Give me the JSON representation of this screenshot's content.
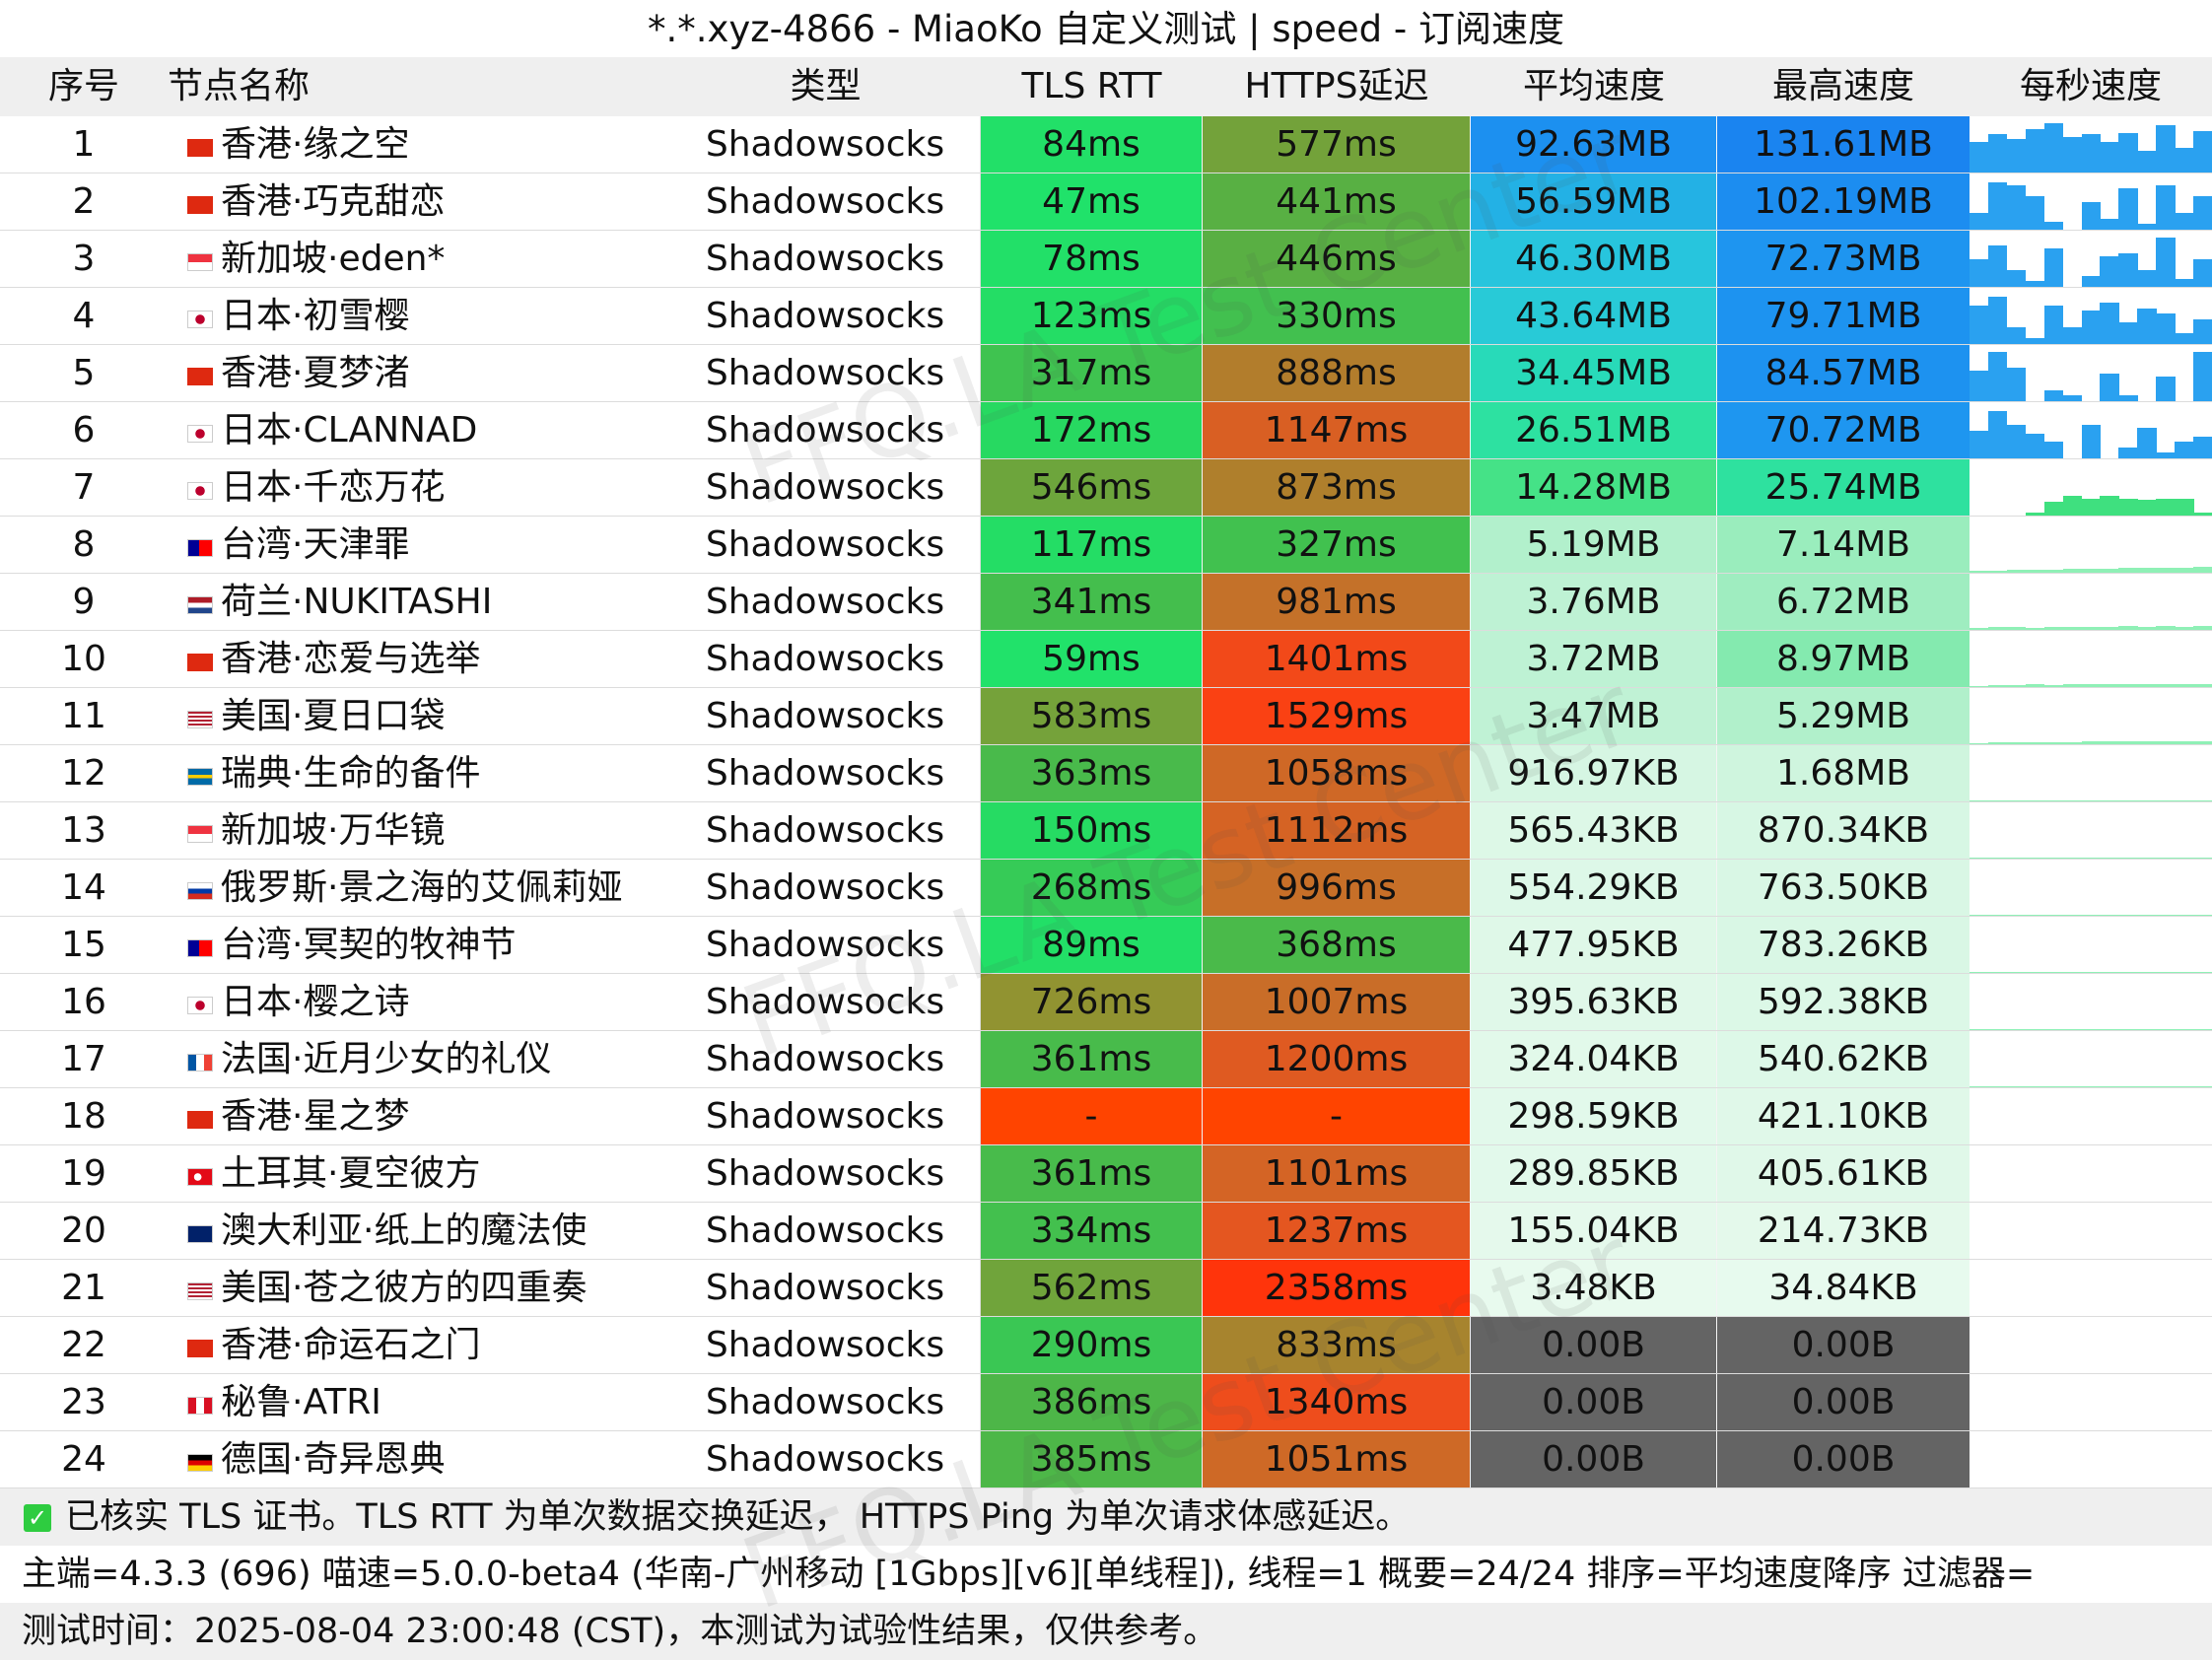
{
  "title": "*.*.xyz-4866 - MiaoKo 自定义测试 | speed - 订阅速度",
  "columns": {
    "idx": "序号",
    "name": "节点名称",
    "type": "类型",
    "tls": "TLS RTT",
    "https": "HTTPS延迟",
    "avg": "平均速度",
    "max": "最高速度",
    "spark": "每秒速度"
  },
  "watermark": "FFQ.LA Test Center",
  "colors": {
    "header_bg": "#efefef",
    "failed_cell": "#646464",
    "latency_good": "#1fe46a",
    "latency_bad": "#ff3c12",
    "speed_fast": "#1a8ff2",
    "sparkline": "#2aa1f0"
  },
  "rows": [
    {
      "idx": "1",
      "flag": "hk",
      "name": "香港·缘之空",
      "type": "Shadowsocks",
      "tls": "84ms",
      "https": "577ms",
      "avg": "92.63MB",
      "max": "131.61MB",
      "spark": [
        0.55,
        0.7,
        0.6,
        0.78,
        0.9,
        0.65,
        0.7,
        0.55,
        0.72,
        0.4,
        0.85,
        0.45,
        0.75
      ]
    },
    {
      "idx": "2",
      "flag": "hk",
      "name": "香港·巧克甜恋",
      "type": "Shadowsocks",
      "tls": "47ms",
      "https": "441ms",
      "avg": "56.59MB",
      "max": "102.19MB",
      "spark": [
        0.3,
        0.85,
        0.8,
        0.6,
        0.15,
        0,
        0.5,
        0.2,
        0.75,
        0.1,
        0.8,
        0.3,
        0.6
      ]
    },
    {
      "idx": "3",
      "flag": "sg",
      "name": "新加坡·eden*",
      "type": "Shadowsocks",
      "tls": "78ms",
      "https": "446ms",
      "avg": "46.30MB",
      "max": "72.73MB",
      "spark": [
        0.5,
        0.75,
        0.3,
        0.1,
        0.7,
        0,
        0.2,
        0.55,
        0.6,
        0.3,
        0.9,
        0.15,
        0.5
      ]
    },
    {
      "idx": "4",
      "flag": "jp",
      "name": "日本·初雪樱",
      "type": "Shadowsocks",
      "tls": "123ms",
      "https": "330ms",
      "avg": "43.64MB",
      "max": "79.71MB",
      "spark": [
        0.7,
        0.85,
        0.3,
        0.1,
        0.7,
        0.3,
        0.6,
        0.75,
        0.4,
        0.65,
        0.55,
        0.2,
        0.45
      ]
    },
    {
      "idx": "5",
      "flag": "hk",
      "name": "香港·夏梦渚",
      "type": "Shadowsocks",
      "tls": "317ms",
      "https": "888ms",
      "avg": "34.45MB",
      "max": "84.57MB",
      "spark": [
        0.55,
        0.9,
        0.6,
        0,
        0.2,
        0.1,
        0,
        0.5,
        0.1,
        0,
        0.45,
        0,
        0.9
      ]
    },
    {
      "idx": "6",
      "flag": "jp",
      "name": "日本·CLANNAD",
      "type": "Shadowsocks",
      "tls": "172ms",
      "https": "1147ms",
      "avg": "26.51MB",
      "max": "70.72MB",
      "spark": [
        0.5,
        0.85,
        0.6,
        0.45,
        0.3,
        0,
        0.6,
        0,
        0.2,
        0.55,
        0.1,
        0.3,
        0.4
      ]
    },
    {
      "idx": "7",
      "flag": "jp",
      "name": "日本·千恋万花",
      "type": "Shadowsocks",
      "tls": "546ms",
      "https": "873ms",
      "avg": "14.28MB",
      "max": "25.74MB",
      "spark": [
        0,
        0,
        0,
        0.05,
        0.25,
        0.35,
        0.3,
        0.35,
        0.3,
        0.28,
        0.3,
        0.3,
        0.05
      ]
    },
    {
      "idx": "8",
      "flag": "tw",
      "name": "台湾·天津罪",
      "type": "Shadowsocks",
      "tls": "117ms",
      "https": "327ms",
      "avg": "5.19MB",
      "max": "7.14MB",
      "spark": [
        0.03,
        0.04,
        0.05,
        0.05,
        0.06,
        0.07,
        0.08,
        0.08,
        0.09,
        0.09,
        0.09,
        0.09,
        0.1
      ]
    },
    {
      "idx": "9",
      "flag": "nl",
      "name": "荷兰·NUKITASHI",
      "type": "Shadowsocks",
      "tls": "341ms",
      "https": "981ms",
      "avg": "3.76MB",
      "max": "6.72MB",
      "spark": [
        0.03,
        0.05,
        0.05,
        0.04,
        0.06,
        0.06,
        0.05,
        0.06,
        0.07,
        0.06,
        0.07,
        0.06,
        0.07
      ]
    },
    {
      "idx": "10",
      "flag": "hk",
      "name": "香港·恋爱与选举",
      "type": "Shadowsocks",
      "tls": "59ms",
      "https": "1401ms",
      "avg": "3.72MB",
      "max": "8.97MB",
      "spark": [
        0.02,
        0.03,
        0.04,
        0.05,
        0.04,
        0.05,
        0.06,
        0.05,
        0.06,
        0.05,
        0.06,
        0.05,
        0.06
      ]
    },
    {
      "idx": "11",
      "flag": "us",
      "name": "美国·夏日口袋",
      "type": "Shadowsocks",
      "tls": "583ms",
      "https": "1529ms",
      "avg": "3.47MB",
      "max": "5.29MB",
      "spark": [
        0.02,
        0.03,
        0.03,
        0.04,
        0.04,
        0.04,
        0.05,
        0.05,
        0.05,
        0.05,
        0.05,
        0.05,
        0.05
      ]
    },
    {
      "idx": "12",
      "flag": "se",
      "name": "瑞典·生命的备件",
      "type": "Shadowsocks",
      "tls": "363ms",
      "https": "1058ms",
      "avg": "916.97KB",
      "max": "1.68MB",
      "spark": [
        0.01,
        0.02,
        0.02,
        0.02,
        0.02,
        0.02,
        0.02,
        0.02,
        0.02,
        0.02,
        0.02,
        0.02,
        0.02
      ]
    },
    {
      "idx": "13",
      "flag": "sg",
      "name": "新加坡·万华镜",
      "type": "Shadowsocks",
      "tls": "150ms",
      "https": "1112ms",
      "avg": "565.43KB",
      "max": "870.34KB",
      "spark": [
        0.01,
        0.01,
        0.01,
        0.01,
        0.01,
        0.01,
        0.01,
        0.01,
        0.01,
        0.01,
        0.01,
        0.01,
        0.01
      ]
    },
    {
      "idx": "14",
      "flag": "ru",
      "name": "俄罗斯·景之海的艾佩莉娅",
      "type": "Shadowsocks",
      "tls": "268ms",
      "https": "996ms",
      "avg": "554.29KB",
      "max": "763.50KB",
      "spark": [
        0.01,
        0.01,
        0.01,
        0.01,
        0.01,
        0.01,
        0.01,
        0.01,
        0.01,
        0.01,
        0.01,
        0.01,
        0.01
      ]
    },
    {
      "idx": "15",
      "flag": "tw",
      "name": "台湾·冥契的牧神节",
      "type": "Shadowsocks",
      "tls": "89ms",
      "https": "368ms",
      "avg": "477.95KB",
      "max": "783.26KB",
      "spark": [
        0.01,
        0.01,
        0.01,
        0.01,
        0.01,
        0.01,
        0.01,
        0.01,
        0.01,
        0.01,
        0.01,
        0.01,
        0.01
      ]
    },
    {
      "idx": "16",
      "flag": "jp",
      "name": "日本·樱之诗",
      "type": "Shadowsocks",
      "tls": "726ms",
      "https": "1007ms",
      "avg": "395.63KB",
      "max": "592.38KB",
      "spark": [
        0.01,
        0.01,
        0.01,
        0.01,
        0.01,
        0.01,
        0.01,
        0.01,
        0.01,
        0.01,
        0.01,
        0.01,
        0.01
      ]
    },
    {
      "idx": "17",
      "flag": "fr",
      "name": "法国·近月少女的礼仪",
      "type": "Shadowsocks",
      "tls": "361ms",
      "https": "1200ms",
      "avg": "324.04KB",
      "max": "540.62KB",
      "spark": [
        0.01,
        0.01,
        0.01,
        0.01,
        0.01,
        0.01,
        0.01,
        0.01,
        0.01,
        0.01,
        0.01,
        0.01,
        0.01
      ]
    },
    {
      "idx": "18",
      "flag": "hk",
      "name": "香港·星之梦",
      "type": "Shadowsocks",
      "tls": "-",
      "https": "-",
      "avg": "298.59KB",
      "max": "421.10KB",
      "spark": [
        0,
        0,
        0,
        0,
        0,
        0,
        0,
        0,
        0,
        0,
        0,
        0,
        0
      ]
    },
    {
      "idx": "19",
      "flag": "tr",
      "name": "土耳其·夏空彼方",
      "type": "Shadowsocks",
      "tls": "361ms",
      "https": "1101ms",
      "avg": "289.85KB",
      "max": "405.61KB",
      "spark": [
        0,
        0,
        0,
        0,
        0,
        0,
        0,
        0,
        0,
        0,
        0,
        0,
        0
      ]
    },
    {
      "idx": "20",
      "flag": "au",
      "name": "澳大利亚·纸上的魔法使",
      "type": "Shadowsocks",
      "tls": "334ms",
      "https": "1237ms",
      "avg": "155.04KB",
      "max": "214.73KB",
      "spark": [
        0,
        0,
        0,
        0,
        0,
        0,
        0,
        0,
        0,
        0,
        0,
        0,
        0
      ]
    },
    {
      "idx": "21",
      "flag": "us",
      "name": "美国·苍之彼方的四重奏",
      "type": "Shadowsocks",
      "tls": "562ms",
      "https": "2358ms",
      "avg": "3.48KB",
      "max": "34.84KB",
      "spark": [
        0,
        0,
        0,
        0,
        0,
        0,
        0,
        0,
        0,
        0,
        0,
        0,
        0
      ]
    },
    {
      "idx": "22",
      "flag": "hk",
      "name": "香港·命运石之门",
      "type": "Shadowsocks",
      "tls": "290ms",
      "https": "833ms",
      "avg": "0.00B",
      "max": "0.00B",
      "spark": [
        0,
        0,
        0,
        0,
        0,
        0,
        0,
        0,
        0,
        0,
        0,
        0,
        0
      ]
    },
    {
      "idx": "23",
      "flag": "pe",
      "name": "秘鲁·ATRI",
      "type": "Shadowsocks",
      "tls": "386ms",
      "https": "1340ms",
      "avg": "0.00B",
      "max": "0.00B",
      "spark": [
        0,
        0,
        0,
        0,
        0,
        0,
        0,
        0,
        0,
        0,
        0,
        0,
        0
      ]
    },
    {
      "idx": "24",
      "flag": "de",
      "name": "德国·奇异恩典",
      "type": "Shadowsocks",
      "tls": "385ms",
      "https": "1051ms",
      "avg": "0.00B",
      "max": "0.00B",
      "spark": [
        0,
        0,
        0,
        0,
        0,
        0,
        0,
        0,
        0,
        0,
        0,
        0,
        0
      ]
    }
  ],
  "footer": {
    "line1": "已核实 TLS 证书。TLS RTT 为单次数据交换延迟， HTTPS Ping 为单次请求体感延迟。",
    "line2": "主端=4.3.3 (696) 喵速=5.0.0-beta4 (华南-广州移动 [1Gbps][v6][单线程]), 线程=1 概要=24/24 排序=平均速度降序 过滤器=",
    "line3": "测试时间：2025-08-04 23:00:48 (CST)，本测试为试验性结果，仅供参考。"
  }
}
